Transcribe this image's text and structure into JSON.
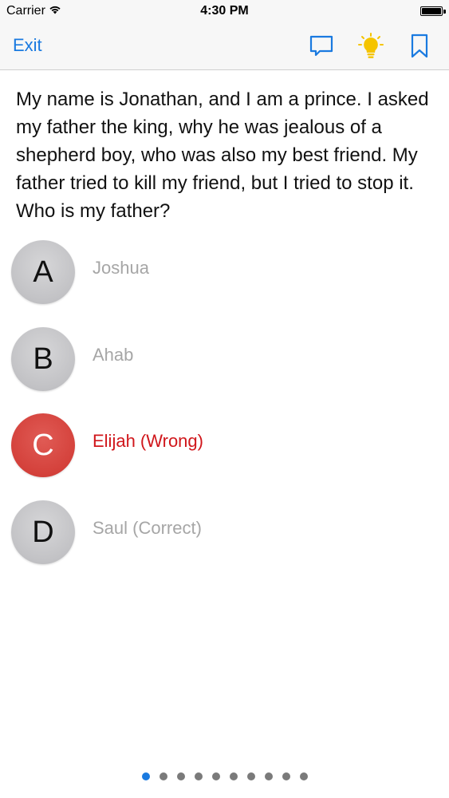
{
  "status_bar": {
    "carrier": "Carrier",
    "time": "4:30 PM",
    "battery_level": 1.0
  },
  "nav": {
    "exit_label": "Exit",
    "icons": [
      "comment-icon",
      "lightbulb-icon",
      "bookmark-icon"
    ],
    "accent_color": "#1a7ae0",
    "hint_color": "#f5c400"
  },
  "question": {
    "text": "My name is Jonathan, and I am a prince. I asked my father the king, why he was jealous of a shepherd boy, who was also my best friend. My father tried to kill my friend, but I tried to stop it. Who is my father?"
  },
  "answers": [
    {
      "letter": "A",
      "text": "Joshua",
      "state": "neutral"
    },
    {
      "letter": "B",
      "text": "Ahab",
      "state": "neutral"
    },
    {
      "letter": "C",
      "text": "Elijah (Wrong)",
      "state": "wrong"
    },
    {
      "letter": "D",
      "text": "Saul (Correct)",
      "state": "neutral"
    }
  ],
  "pager": {
    "total": 10,
    "current": 1
  },
  "colors": {
    "wrong": "#d0161b",
    "neutral_text": "#a6a6a6"
  }
}
